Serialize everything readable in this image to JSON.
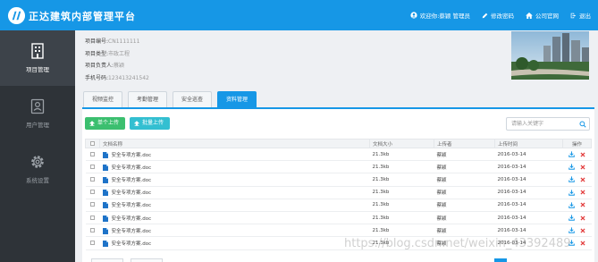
{
  "app": {
    "title": "正达建筑内部管理平台",
    "welcome": "欢迎你:蔡颖 管理员",
    "change_password": "修改密码",
    "company_site": "公司官网",
    "logout": "退出"
  },
  "sidebar": {
    "items": [
      {
        "label": "项目管理",
        "icon": "building-icon",
        "active": true
      },
      {
        "label": "用户管理",
        "icon": "user-card-icon",
        "active": false
      },
      {
        "label": "系统设置",
        "icon": "gear-icon",
        "active": false
      }
    ]
  },
  "project": {
    "number_label": "项目编号:",
    "number": "CN1111111",
    "type_label": "项目类型:",
    "type": "市政工程",
    "owner_label": "项目负责人:",
    "owner": "蔡颖",
    "phone_label": "手机号码:",
    "phone": "123413241542"
  },
  "tabs": [
    {
      "label": "视频监控",
      "active": false
    },
    {
      "label": "考勤管理",
      "active": false
    },
    {
      "label": "安全巡查",
      "active": false
    },
    {
      "label": "资料管理",
      "active": true
    }
  ],
  "toolbar": {
    "single_upload": "单个上传",
    "batch_upload": "批量上传",
    "search_placeholder": "请输入关键字"
  },
  "table": {
    "headers": [
      "文档名称",
      "文档大小",
      "上传者",
      "上传时间",
      "操作"
    ],
    "rows": [
      {
        "name": "安全专项方案.doc",
        "size": "21.3kb",
        "uploader": "蔡颖",
        "date": "2016-03-14"
      },
      {
        "name": "安全专项方案.doc",
        "size": "21.3kb",
        "uploader": "蔡颖",
        "date": "2016-03-14"
      },
      {
        "name": "安全专项方案.doc",
        "size": "21.3kb",
        "uploader": "蔡颖",
        "date": "2016-03-14"
      },
      {
        "name": "安全专项方案.doc",
        "size": "21.3kb",
        "uploader": "蔡颖",
        "date": "2016-03-14"
      },
      {
        "name": "安全专项方案.doc",
        "size": "21.3kb",
        "uploader": "蔡颖",
        "date": "2016-03-14"
      },
      {
        "name": "安全专项方案.doc",
        "size": "21.3kb",
        "uploader": "蔡颖",
        "date": "2016-03-14"
      },
      {
        "name": "安全专项方案.doc",
        "size": "21.3kb",
        "uploader": "蔡颖",
        "date": "2016-03-14"
      },
      {
        "name": "安全专项方案.doc",
        "size": "21.3kb",
        "uploader": "蔡颖",
        "date": "2016-03-14"
      }
    ]
  },
  "watermark": "https://blog.csdn.net/weixin_43392489",
  "colors": {
    "primary": "#1697e6",
    "sidebar": "#2e3338",
    "success": "#3bbf6f",
    "info": "#33bfd1",
    "danger": "#e23b3b"
  }
}
